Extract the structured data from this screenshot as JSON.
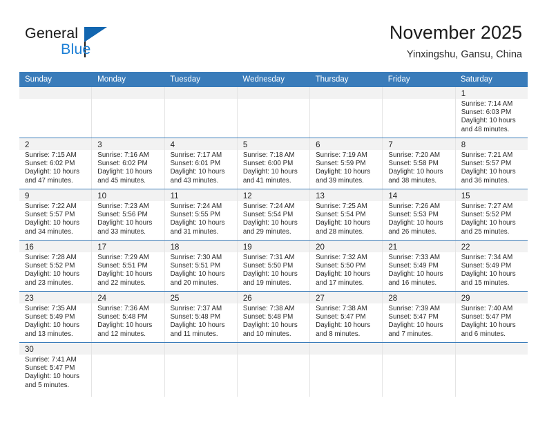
{
  "brand": {
    "name_part1": "General",
    "name_part2": "Blue",
    "triangle_color": "#1266b0",
    "blue_text_color": "#1c7fd6"
  },
  "header": {
    "title": "November 2025",
    "subtitle": "Yinxingshu, Gansu, China"
  },
  "theme": {
    "header_blue": "#3a7cba",
    "daynum_band": "#f2f2f2",
    "cell_divider": "#e4e4e4",
    "text": "#2a2a2a"
  },
  "weekdays": [
    "Sunday",
    "Monday",
    "Tuesday",
    "Wednesday",
    "Thursday",
    "Friday",
    "Saturday"
  ],
  "weeks": [
    [
      {
        "day": "",
        "lines": [
          "",
          "",
          "",
          ""
        ]
      },
      {
        "day": "",
        "lines": [
          "",
          "",
          "",
          ""
        ]
      },
      {
        "day": "",
        "lines": [
          "",
          "",
          "",
          ""
        ]
      },
      {
        "day": "",
        "lines": [
          "",
          "",
          "",
          ""
        ]
      },
      {
        "day": "",
        "lines": [
          "",
          "",
          "",
          ""
        ]
      },
      {
        "day": "",
        "lines": [
          "",
          "",
          "",
          ""
        ]
      },
      {
        "day": "1",
        "lines": [
          "Sunrise: 7:14 AM",
          "Sunset: 6:03 PM",
          "Daylight: 10 hours",
          "and 48 minutes."
        ]
      }
    ],
    [
      {
        "day": "2",
        "lines": [
          "Sunrise: 7:15 AM",
          "Sunset: 6:02 PM",
          "Daylight: 10 hours",
          "and 47 minutes."
        ]
      },
      {
        "day": "3",
        "lines": [
          "Sunrise: 7:16 AM",
          "Sunset: 6:02 PM",
          "Daylight: 10 hours",
          "and 45 minutes."
        ]
      },
      {
        "day": "4",
        "lines": [
          "Sunrise: 7:17 AM",
          "Sunset: 6:01 PM",
          "Daylight: 10 hours",
          "and 43 minutes."
        ]
      },
      {
        "day": "5",
        "lines": [
          "Sunrise: 7:18 AM",
          "Sunset: 6:00 PM",
          "Daylight: 10 hours",
          "and 41 minutes."
        ]
      },
      {
        "day": "6",
        "lines": [
          "Sunrise: 7:19 AM",
          "Sunset: 5:59 PM",
          "Daylight: 10 hours",
          "and 39 minutes."
        ]
      },
      {
        "day": "7",
        "lines": [
          "Sunrise: 7:20 AM",
          "Sunset: 5:58 PM",
          "Daylight: 10 hours",
          "and 38 minutes."
        ]
      },
      {
        "day": "8",
        "lines": [
          "Sunrise: 7:21 AM",
          "Sunset: 5:57 PM",
          "Daylight: 10 hours",
          "and 36 minutes."
        ]
      }
    ],
    [
      {
        "day": "9",
        "lines": [
          "Sunrise: 7:22 AM",
          "Sunset: 5:57 PM",
          "Daylight: 10 hours",
          "and 34 minutes."
        ]
      },
      {
        "day": "10",
        "lines": [
          "Sunrise: 7:23 AM",
          "Sunset: 5:56 PM",
          "Daylight: 10 hours",
          "and 33 minutes."
        ]
      },
      {
        "day": "11",
        "lines": [
          "Sunrise: 7:24 AM",
          "Sunset: 5:55 PM",
          "Daylight: 10 hours",
          "and 31 minutes."
        ]
      },
      {
        "day": "12",
        "lines": [
          "Sunrise: 7:24 AM",
          "Sunset: 5:54 PM",
          "Daylight: 10 hours",
          "and 29 minutes."
        ]
      },
      {
        "day": "13",
        "lines": [
          "Sunrise: 7:25 AM",
          "Sunset: 5:54 PM",
          "Daylight: 10 hours",
          "and 28 minutes."
        ]
      },
      {
        "day": "14",
        "lines": [
          "Sunrise: 7:26 AM",
          "Sunset: 5:53 PM",
          "Daylight: 10 hours",
          "and 26 minutes."
        ]
      },
      {
        "day": "15",
        "lines": [
          "Sunrise: 7:27 AM",
          "Sunset: 5:52 PM",
          "Daylight: 10 hours",
          "and 25 minutes."
        ]
      }
    ],
    [
      {
        "day": "16",
        "lines": [
          "Sunrise: 7:28 AM",
          "Sunset: 5:52 PM",
          "Daylight: 10 hours",
          "and 23 minutes."
        ]
      },
      {
        "day": "17",
        "lines": [
          "Sunrise: 7:29 AM",
          "Sunset: 5:51 PM",
          "Daylight: 10 hours",
          "and 22 minutes."
        ]
      },
      {
        "day": "18",
        "lines": [
          "Sunrise: 7:30 AM",
          "Sunset: 5:51 PM",
          "Daylight: 10 hours",
          "and 20 minutes."
        ]
      },
      {
        "day": "19",
        "lines": [
          "Sunrise: 7:31 AM",
          "Sunset: 5:50 PM",
          "Daylight: 10 hours",
          "and 19 minutes."
        ]
      },
      {
        "day": "20",
        "lines": [
          "Sunrise: 7:32 AM",
          "Sunset: 5:50 PM",
          "Daylight: 10 hours",
          "and 17 minutes."
        ]
      },
      {
        "day": "21",
        "lines": [
          "Sunrise: 7:33 AM",
          "Sunset: 5:49 PM",
          "Daylight: 10 hours",
          "and 16 minutes."
        ]
      },
      {
        "day": "22",
        "lines": [
          "Sunrise: 7:34 AM",
          "Sunset: 5:49 PM",
          "Daylight: 10 hours",
          "and 15 minutes."
        ]
      }
    ],
    [
      {
        "day": "23",
        "lines": [
          "Sunrise: 7:35 AM",
          "Sunset: 5:49 PM",
          "Daylight: 10 hours",
          "and 13 minutes."
        ]
      },
      {
        "day": "24",
        "lines": [
          "Sunrise: 7:36 AM",
          "Sunset: 5:48 PM",
          "Daylight: 10 hours",
          "and 12 minutes."
        ]
      },
      {
        "day": "25",
        "lines": [
          "Sunrise: 7:37 AM",
          "Sunset: 5:48 PM",
          "Daylight: 10 hours",
          "and 11 minutes."
        ]
      },
      {
        "day": "26",
        "lines": [
          "Sunrise: 7:38 AM",
          "Sunset: 5:48 PM",
          "Daylight: 10 hours",
          "and 10 minutes."
        ]
      },
      {
        "day": "27",
        "lines": [
          "Sunrise: 7:38 AM",
          "Sunset: 5:47 PM",
          "Daylight: 10 hours",
          "and 8 minutes."
        ]
      },
      {
        "day": "28",
        "lines": [
          "Sunrise: 7:39 AM",
          "Sunset: 5:47 PM",
          "Daylight: 10 hours",
          "and 7 minutes."
        ]
      },
      {
        "day": "29",
        "lines": [
          "Sunrise: 7:40 AM",
          "Sunset: 5:47 PM",
          "Daylight: 10 hours",
          "and 6 minutes."
        ]
      }
    ],
    [
      {
        "day": "30",
        "lines": [
          "Sunrise: 7:41 AM",
          "Sunset: 5:47 PM",
          "Daylight: 10 hours",
          "and 5 minutes."
        ]
      },
      {
        "day": "",
        "lines": [
          "",
          "",
          "",
          ""
        ]
      },
      {
        "day": "",
        "lines": [
          "",
          "",
          "",
          ""
        ]
      },
      {
        "day": "",
        "lines": [
          "",
          "",
          "",
          ""
        ]
      },
      {
        "day": "",
        "lines": [
          "",
          "",
          "",
          ""
        ]
      },
      {
        "day": "",
        "lines": [
          "",
          "",
          "",
          ""
        ]
      },
      {
        "day": "",
        "lines": [
          "",
          "",
          "",
          ""
        ]
      }
    ]
  ]
}
